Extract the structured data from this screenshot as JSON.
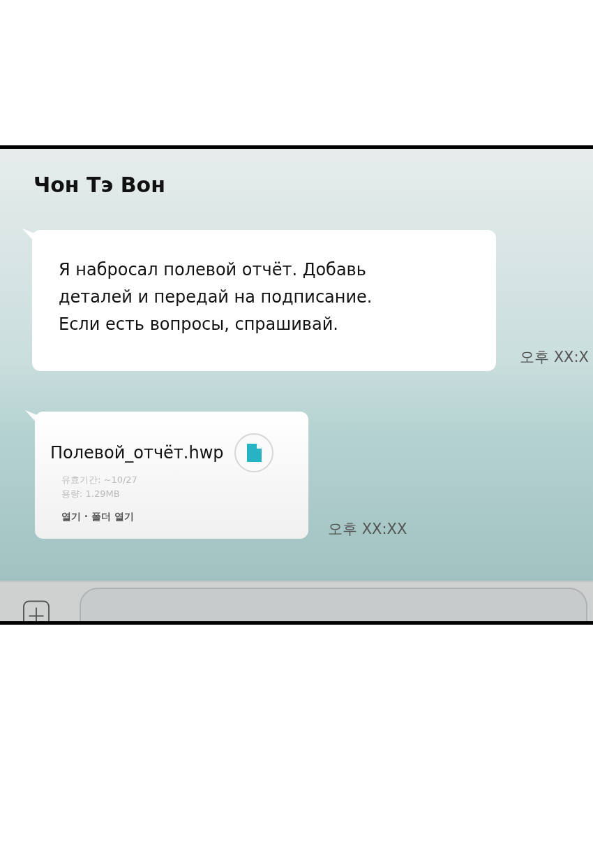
{
  "chat": {
    "title": "Чон Тэ Вон"
  },
  "messages": [
    {
      "kind": "text",
      "text": "Я набросал полевой отчёт. Добавь деталей и передай на подписание. Если есть вопросы, спрашивай.",
      "time": "오후 XX:X"
    },
    {
      "kind": "file",
      "file_name": "Полевой_отчёт.hwp",
      "expiry": "유효기간: ~10/27",
      "size": "용량: 1.29MB",
      "actions": "열기 · 폴더 열기",
      "time": "오후 XX:XX"
    }
  ]
}
